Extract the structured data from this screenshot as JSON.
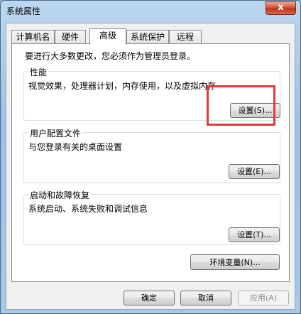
{
  "window": {
    "title": "系统属性",
    "close_label": "x"
  },
  "tabs": [
    {
      "label": "计算机名"
    },
    {
      "label": "硬件"
    },
    {
      "label": "高级"
    },
    {
      "label": "系统保护"
    },
    {
      "label": "远程"
    }
  ],
  "active_tab": "高级",
  "admin_note": "要进行大多数更改，您必须作为管理员登录。",
  "performance": {
    "label": "性能",
    "description": "视觉效果，处理器计划，内存使用，以及虚拟内存",
    "button": "设置(S)..."
  },
  "user_profiles": {
    "label": "用户配置文件",
    "description": "与您登录有关的桌面设置",
    "button": "设置(E)..."
  },
  "startup_recovery": {
    "label": "启动和故障恢复",
    "description": "系统启动、系统失败和调试信息",
    "button": "设置(T)..."
  },
  "env_button": "环境变量(N)...",
  "footer": {
    "ok": "确定",
    "cancel": "取消",
    "apply": "应用(A)"
  },
  "colors": {
    "highlight": "#e3393c",
    "title_bar": "#bcd6ee"
  }
}
